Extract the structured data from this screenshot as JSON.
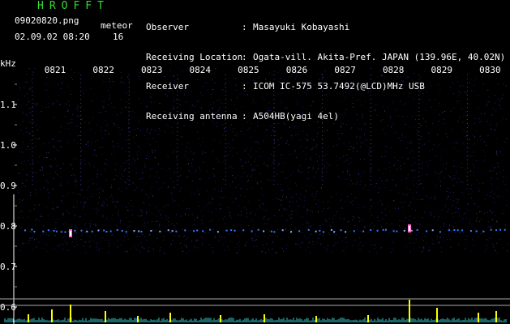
{
  "header": {
    "title": "HROFFT",
    "filename": "09020820.png",
    "meteor_label": "meteor",
    "meteor_count": "16",
    "datetime": "02.09.02 08:20"
  },
  "info": [
    {
      "label": "Observer",
      "value": "Masayuki Kobayashi"
    },
    {
      "label": "Receiving Location",
      "value": "Ogata-vill. Akita-Pref. JAPAN (139.96E, 40.02N)"
    },
    {
      "label": "Receiver",
      "value": "ICOM IC-575 53.7492(@LCD)MHz USB"
    },
    {
      "label": "Receiving antenna",
      "value": "A504HB(yagi 4el)"
    }
  ],
  "spectrogram": {
    "frequency_unit": "kHz",
    "y_ticks": [
      "1.1",
      "1.0",
      "0.9",
      "0.8",
      "0.7",
      "0.6"
    ],
    "time_ticks": [
      "0821",
      "0822",
      "0823",
      "0824",
      "0825",
      "0826",
      "0827",
      "0828",
      "0829",
      "0830"
    ],
    "colors": {
      "background": "#000000",
      "noise": "#2a2a8a",
      "trace": "#3a7aff",
      "meteor": "#ff66cc",
      "profile": "#ffff00",
      "profile_base": "#33cccc",
      "tick": "#ffffff"
    }
  }
}
